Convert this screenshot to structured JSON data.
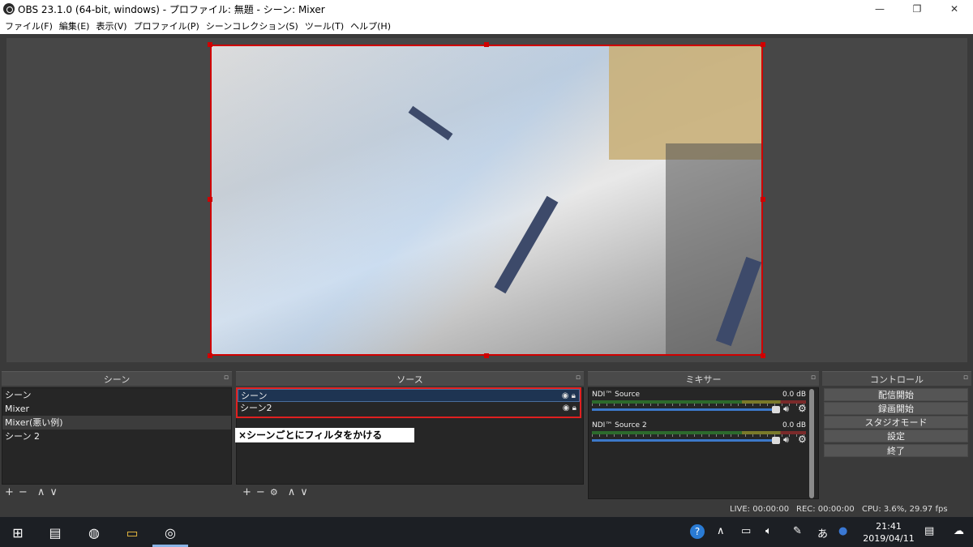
{
  "window": {
    "title": "OBS 23.1.0 (64-bit, windows) - プロファイル: 無題 - シーン: Mixer",
    "buttons": {
      "minimize": "—",
      "restore": "❐",
      "close": "✕"
    }
  },
  "menu": [
    "ファイル(F)",
    "編集(E)",
    "表示(V)",
    "プロファイル(P)",
    "シーンコレクション(S)",
    "ツール(T)",
    "ヘルプ(H)"
  ],
  "scenes": {
    "header": "シーン",
    "items": [
      "シーン",
      "Mixer",
      "Mixer(悪い例)",
      "シーン 2"
    ],
    "selected_index": 2,
    "toolbar": [
      "+",
      "−",
      "∧",
      "∨"
    ]
  },
  "sources": {
    "header": "ソース",
    "items": [
      "シーン",
      "シーン2"
    ],
    "toolbar": [
      "+",
      "−",
      "⚙",
      "∧",
      "∨"
    ]
  },
  "annotation": "×シーンごとにフィルタをかける",
  "mixer": {
    "header": "ミキサー",
    "tracks": [
      {
        "name": "NDI™ Source",
        "db": "0.0 dB",
        "volume": 1.0
      },
      {
        "name": "NDI™ Source 2",
        "db": "0.0 dB",
        "volume": 1.0
      }
    ]
  },
  "controls": {
    "header": "コントロール",
    "buttons": [
      "配信開始",
      "録画開始",
      "スタジオモード",
      "設定",
      "終了"
    ]
  },
  "status": {
    "live": "LIVE: 00:00:00",
    "rec": "REC: 00:00:00",
    "cpu": "CPU: 3.6%, 29.97 fps"
  },
  "taskbar": {
    "ime": "あ",
    "time": "21:41",
    "date": "2019/04/11"
  },
  "colors": {
    "selection_border": "#d00000",
    "annotation_border": "#e02020",
    "slider": "#3c78c8"
  }
}
